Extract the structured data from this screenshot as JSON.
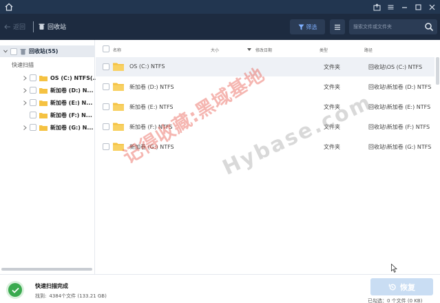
{
  "toolbar": {
    "back_label": "返回",
    "breadcrumb_label": "回收站",
    "filter_label": "筛选",
    "search_placeholder": "搜索文件或文件夹"
  },
  "sidebar": {
    "root_label": "回收站(55)",
    "section_label": "快速扫描",
    "items": [
      {
        "label": "OS (C:) NTFS(..."
      },
      {
        "label": "新加卷 (D:) N..."
      },
      {
        "label": "新加卷 (E:) N..."
      },
      {
        "label": "新加卷 (F:) N..."
      },
      {
        "label": "新加卷 (G:) N..."
      }
    ]
  },
  "table": {
    "columns": {
      "name": "名称",
      "size": "大小",
      "modified": "修改日期",
      "type": "类型",
      "path": "路径"
    },
    "rows": [
      {
        "name": "OS (C:) NTFS",
        "type": "文件夹",
        "path": "回收站\\OS (C:) NTFS"
      },
      {
        "name": "新加卷 (D:) NTFS",
        "type": "文件夹",
        "path": "回收站\\新加卷 (D:) NTFS"
      },
      {
        "name": "新加卷 (E:) NTFS",
        "type": "文件夹",
        "path": "回收站\\新加卷 (E:) NTFS"
      },
      {
        "name": "新加卷 (F:) NTFS",
        "type": "文件夹",
        "path": "回收站\\新加卷 (F:) NTFS"
      },
      {
        "name": "新加卷 (G:) NTFS",
        "type": "文件夹",
        "path": "回收站\\新加卷 (G:) NTFS"
      }
    ]
  },
  "footer": {
    "scan_status": "快速扫描完成",
    "found_label": "找到:",
    "found_value": "4384个文件 (133.21 GB)",
    "recover_label": "恢复",
    "selected_info": "已勾选：0 个文件 (0 KB)"
  },
  "watermark": {
    "cn_text": "记得收藏:黑域基地",
    "en_text": "Hybase.com"
  },
  "colors": {
    "titlebar": "#223650",
    "toolbar": "#1d2b40",
    "accent": "#7fb0ff",
    "folder": "#f5c242",
    "success": "#3aaa4f",
    "recover_disabled": "#c9ddf3"
  }
}
